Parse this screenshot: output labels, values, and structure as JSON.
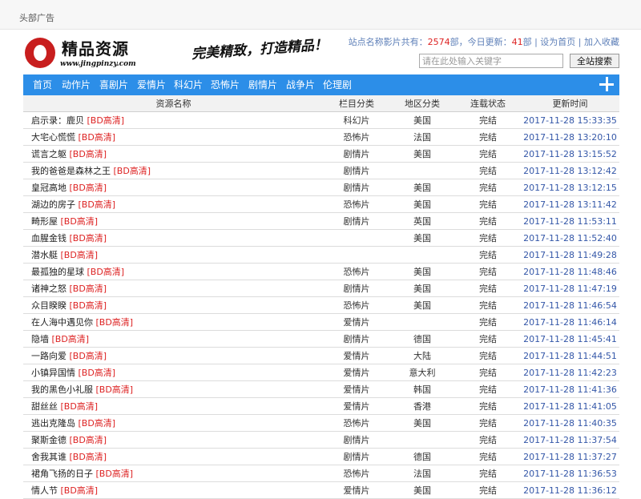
{
  "top_ad": "头部广告",
  "logo": {
    "title": "精品资源",
    "url": "www.jingpinzy.com"
  },
  "slogan": "完美精致，打造精品！",
  "stats": {
    "prefix": "站点名称影片共有：",
    "total": "2574",
    "total_unit": "部，今日更新：",
    "today": "41",
    "today_unit": "部",
    "sep1": " | ",
    "set_home": "设为首页",
    "sep2": " | ",
    "favorite": "加入收藏"
  },
  "search": {
    "placeholder": "请在此处输入关键字",
    "button": "全站搜索"
  },
  "nav": [
    "首页",
    "动作片",
    "喜剧片",
    "爱情片",
    "科幻片",
    "恐怖片",
    "剧情片",
    "战争片",
    "伦理剧"
  ],
  "columns": [
    "资源名称",
    "栏目分类",
    "地区分类",
    "连载状态",
    "更新时间"
  ],
  "rows": [
    {
      "name": "启示录：鹿贝",
      "tag": "[BD高清]",
      "cat": "科幻片",
      "region": "美国",
      "status": "完结",
      "time": "2017-11-28 15:33:35"
    },
    {
      "name": "大宅心慌慌",
      "tag": "[BD高清]",
      "cat": "恐怖片",
      "region": "法国",
      "status": "完结",
      "time": "2017-11-28 13:20:10"
    },
    {
      "name": "谎言之躯",
      "tag": "[BD高清]",
      "cat": "剧情片",
      "region": "美国",
      "status": "完结",
      "time": "2017-11-28 13:15:52"
    },
    {
      "name": "我的爸爸是森林之王",
      "tag": "[BD高清]",
      "cat": "剧情片",
      "region": "",
      "status": "完结",
      "time": "2017-11-28 13:12:42"
    },
    {
      "name": "皇冠高地",
      "tag": "[BD高清]",
      "cat": "剧情片",
      "region": "美国",
      "status": "完结",
      "time": "2017-11-28 13:12:15"
    },
    {
      "name": "湖边的房子",
      "tag": "[BD高清]",
      "cat": "恐怖片",
      "region": "美国",
      "status": "完结",
      "time": "2017-11-28 13:11:42"
    },
    {
      "name": "畸形屋",
      "tag": "[BD高清]",
      "cat": "剧情片",
      "region": "英国",
      "status": "完结",
      "time": "2017-11-28 11:53:11"
    },
    {
      "name": "血腥金钱",
      "tag": "[BD高清]",
      "cat": "",
      "region": "美国",
      "status": "完结",
      "time": "2017-11-28 11:52:40"
    },
    {
      "name": "潜水艇",
      "tag": "[BD高清]",
      "cat": "",
      "region": "",
      "status": "完结",
      "time": "2017-11-28 11:49:28"
    },
    {
      "name": "最孤独的星球",
      "tag": "[BD高清]",
      "cat": "恐怖片",
      "region": "美国",
      "status": "完结",
      "time": "2017-11-28 11:48:46"
    },
    {
      "name": "诸神之怒",
      "tag": "[BD高清]",
      "cat": "剧情片",
      "region": "美国",
      "status": "完结",
      "time": "2017-11-28 11:47:19"
    },
    {
      "name": "众目睽睽",
      "tag": "[BD高清]",
      "cat": "恐怖片",
      "region": "美国",
      "status": "完结",
      "time": "2017-11-28 11:46:54"
    },
    {
      "name": "在人海中遇见你",
      "tag": "[BD高清]",
      "cat": "爱情片",
      "region": "",
      "status": "完结",
      "time": "2017-11-28 11:46:14"
    },
    {
      "name": "隐墙",
      "tag": "[BD高清]",
      "cat": "剧情片",
      "region": "德国",
      "status": "完结",
      "time": "2017-11-28 11:45:41"
    },
    {
      "name": "一路向爱",
      "tag": "[BD高清]",
      "cat": "爱情片",
      "region": "大陆",
      "status": "完结",
      "time": "2017-11-28 11:44:51"
    },
    {
      "name": "小镇异国情",
      "tag": "[BD高清]",
      "cat": "爱情片",
      "region": "意大利",
      "status": "完结",
      "time": "2017-11-28 11:42:23"
    },
    {
      "name": "我的黑色小礼服",
      "tag": "[BD高清]",
      "cat": "爱情片",
      "region": "韩国",
      "status": "完结",
      "time": "2017-11-28 11:41:36"
    },
    {
      "name": "甜丝丝",
      "tag": "[BD高清]",
      "cat": "爱情片",
      "region": "香港",
      "status": "完结",
      "time": "2017-11-28 11:41:05"
    },
    {
      "name": "逃出克隆岛",
      "tag": "[BD高清]",
      "cat": "恐怖片",
      "region": "美国",
      "status": "完结",
      "time": "2017-11-28 11:40:35"
    },
    {
      "name": "聚斯金德",
      "tag": "[BD高清]",
      "cat": "剧情片",
      "region": "",
      "status": "完结",
      "time": "2017-11-28 11:37:54"
    },
    {
      "name": "舍我其谁",
      "tag": "[BD高清]",
      "cat": "剧情片",
      "region": "德国",
      "status": "完结",
      "time": "2017-11-28 11:37:27"
    },
    {
      "name": "裙角飞扬的日子",
      "tag": "[BD高清]",
      "cat": "恐怖片",
      "region": "法国",
      "status": "完结",
      "time": "2017-11-28 11:36:53"
    },
    {
      "name": "情人节",
      "tag": "[BD高清]",
      "cat": "爱情片",
      "region": "美国",
      "status": "完结",
      "time": "2017-11-28 11:36:12"
    }
  ]
}
